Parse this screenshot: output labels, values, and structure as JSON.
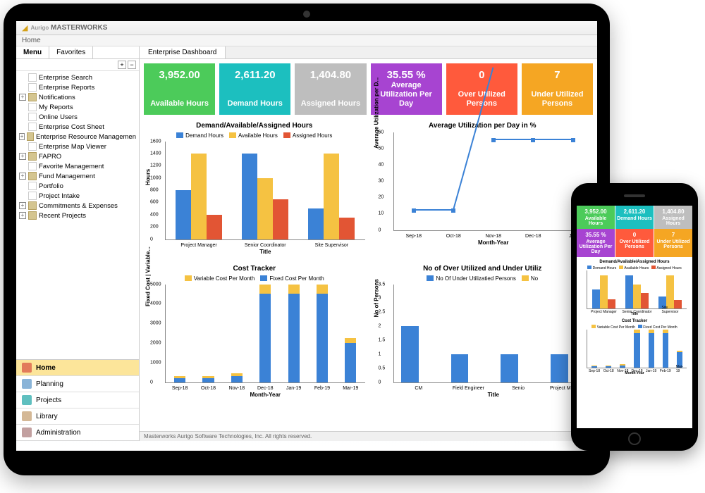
{
  "brand": "MASTERWORKS",
  "brand_prefix": "Aurigo",
  "breadcrumb": "Home",
  "tabs": {
    "menu": "Menu",
    "favorites": "Favorites"
  },
  "tree": {
    "items": [
      {
        "label": "Enterprise Search",
        "expandable": false
      },
      {
        "label": "Enterprise Reports",
        "expandable": false
      },
      {
        "label": "Notifications",
        "expandable": true
      },
      {
        "label": "My Reports",
        "expandable": false
      },
      {
        "label": "Online Users",
        "expandable": false
      },
      {
        "label": "Enterprise Cost Sheet",
        "expandable": false
      },
      {
        "label": "Enterprise Resource Managemen",
        "expandable": true
      },
      {
        "label": "Enterprise Map Viewer",
        "expandable": false
      },
      {
        "label": "FAPRO",
        "expandable": true
      },
      {
        "label": "Favorite Management",
        "expandable": false
      },
      {
        "label": "Fund Management",
        "expandable": true
      },
      {
        "label": "Portfolio",
        "expandable": false
      },
      {
        "label": "Project Intake",
        "expandable": false
      },
      {
        "label": "Commitments & Expenses",
        "expandable": true
      },
      {
        "label": "Recent Projects",
        "expandable": true
      }
    ]
  },
  "nav": {
    "items": [
      {
        "label": "Home",
        "active": true,
        "color": "#e27b5a"
      },
      {
        "label": "Planning",
        "active": false,
        "color": "#8ab4d8"
      },
      {
        "label": "Projects",
        "active": false,
        "color": "#5fbfbf"
      },
      {
        "label": "Library",
        "active": false,
        "color": "#d4b896"
      },
      {
        "label": "Administration",
        "active": false,
        "color": "#c2a0a0"
      }
    ]
  },
  "content_tab": "Enterprise Dashboard",
  "kpis": [
    {
      "value": "3,952.00",
      "label": "Available Hours",
      "color": "#4CCB5A"
    },
    {
      "value": "2,611.20",
      "label": "Demand Hours",
      "color": "#1CBFBF"
    },
    {
      "value": "1,404.80",
      "label": "Assigned Hours",
      "color": "#BEBEBE"
    },
    {
      "value": "35.55 %",
      "label": "Average Utilization Per Day",
      "color": "#A744D1"
    },
    {
      "value": "0",
      "label": "Over Utilized Persons",
      "color": "#FF5A3C"
    },
    {
      "value": "7",
      "label": "Under Utilized Persons",
      "color": "#F5A623"
    }
  ],
  "footer": "Masterworks Aurigo Software Technologies, Inc. All rights reserved.",
  "chart_data": [
    {
      "id": "demand_avail_assigned",
      "title": "Demand/Available/Assigned Hours",
      "type": "bar",
      "categories": [
        "Project Manager",
        "Senior Coordinator",
        "Site Supervisor"
      ],
      "series": [
        {
          "name": "Demand Hours",
          "color": "#3b82d6",
          "values": [
            800,
            1400,
            500
          ]
        },
        {
          "name": "Available Hours",
          "color": "#f5c242",
          "values": [
            1400,
            1000,
            1400
          ]
        },
        {
          "name": "Assigned Hours",
          "color": "#e25534",
          "values": [
            400,
            650,
            350
          ]
        }
      ],
      "ylabel": "Hours",
      "xlabel": "Title",
      "ylim": [
        0,
        1600
      ],
      "yticks": [
        0,
        200,
        400,
        600,
        800,
        1000,
        1200,
        1400,
        1600
      ]
    },
    {
      "id": "avg_util",
      "title": "Average Utilization per Day in %",
      "type": "line",
      "x": [
        "Sep-18",
        "Oct-18",
        "Nov-18",
        "Dec-18",
        "Jan"
      ],
      "series": [
        {
          "name": "Utilization",
          "color": "#3b82d6",
          "values": [
            12,
            12,
            55,
            55,
            55
          ]
        }
      ],
      "ylabel": "Average Utilization per D...",
      "xlabel": "Month-Year",
      "ylim": [
        0,
        60
      ],
      "yticks": [
        0,
        10,
        20,
        30,
        40,
        50,
        60
      ]
    },
    {
      "id": "cost_tracker",
      "title": "Cost Tracker",
      "type": "bar",
      "stacked": true,
      "categories": [
        "Sep-18",
        "Oct-18",
        "Nov-18",
        "Dec-18",
        "Jan-19",
        "Feb-19",
        "Mar-19"
      ],
      "series": [
        {
          "name": "Variable Cost Per Month",
          "color": "#f5c242",
          "values": [
            100,
            100,
            150,
            500,
            500,
            500,
            250
          ]
        },
        {
          "name": "Fixed Cost Per Month",
          "color": "#3b82d6",
          "values": [
            200,
            200,
            300,
            4500,
            4500,
            4500,
            2000
          ]
        }
      ],
      "ylabel": "Fixed Cost | Variable...",
      "xlabel": "Month-Year",
      "ylim": [
        0,
        5000
      ],
      "yticks": [
        0,
        1000,
        2000,
        3000,
        4000,
        5000
      ]
    },
    {
      "id": "over_under",
      "title": "No of Over Utilized and Under Utiliz",
      "type": "bar",
      "categories": [
        "CM",
        "Field Engineer",
        "Senio",
        "Project Manager"
      ],
      "series": [
        {
          "name": "No Of Under Utilizatied Persons",
          "color": "#3b82d6",
          "values": [
            2,
            1,
            1,
            1
          ]
        },
        {
          "name": "No",
          "color": "#f5c242",
          "values": [
            0,
            0,
            0,
            0
          ]
        }
      ],
      "ylabel": "No of Persons",
      "xlabel": "Title",
      "ylim": [
        0,
        3.5
      ],
      "yticks": [
        0,
        0.5,
        1,
        1.5,
        2,
        2.5,
        3,
        3.5
      ]
    }
  ]
}
